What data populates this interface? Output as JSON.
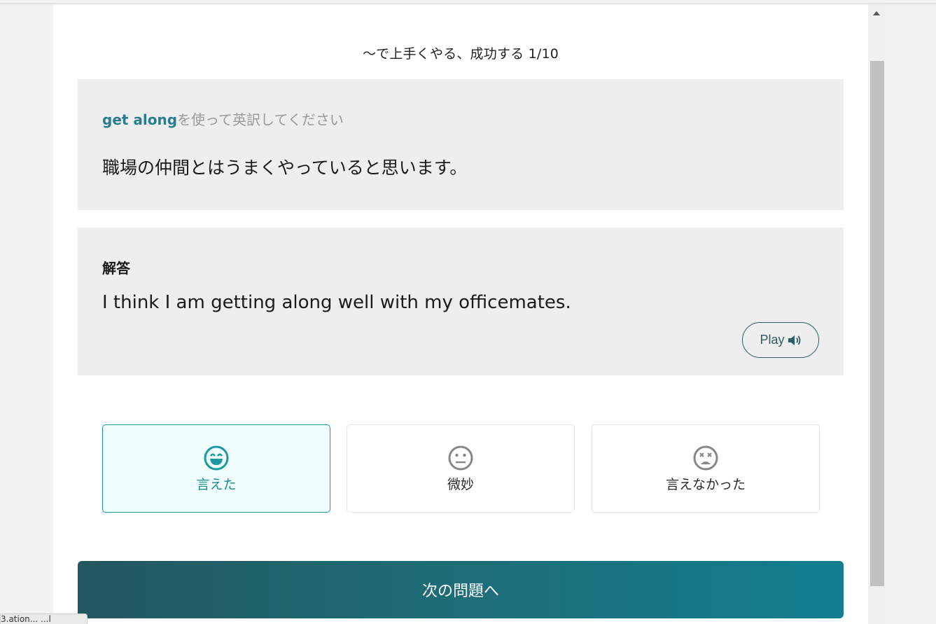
{
  "header": {
    "title": "～で上手くやる、成功する  1/10"
  },
  "question_card": {
    "keyword": "get along",
    "instruction_suffix": "を使って英訳してください",
    "sentence_ja": "職場の仲間とはうまくやっていると思います。"
  },
  "answer_card": {
    "label": "解答",
    "sentence_en": "I think I am getting along well with my officemates.",
    "play_label": "Play"
  },
  "choices": [
    {
      "label": "言えた",
      "icon": "smile-icon",
      "selected": true
    },
    {
      "label": "微妙",
      "icon": "neutral-face-icon",
      "selected": false
    },
    {
      "label": "言えなかった",
      "icon": "dizzy-face-icon",
      "selected": false
    }
  ],
  "next_button": {
    "label": "次の問題へ"
  },
  "status_bar": {
    "text": "3.ation... ...l"
  },
  "colors": {
    "accent": "#1a9aa0",
    "card_bg": "#eeeeee",
    "keyword": "#2a7d8c",
    "button_start": "#22585f",
    "button_end": "#127e90"
  }
}
